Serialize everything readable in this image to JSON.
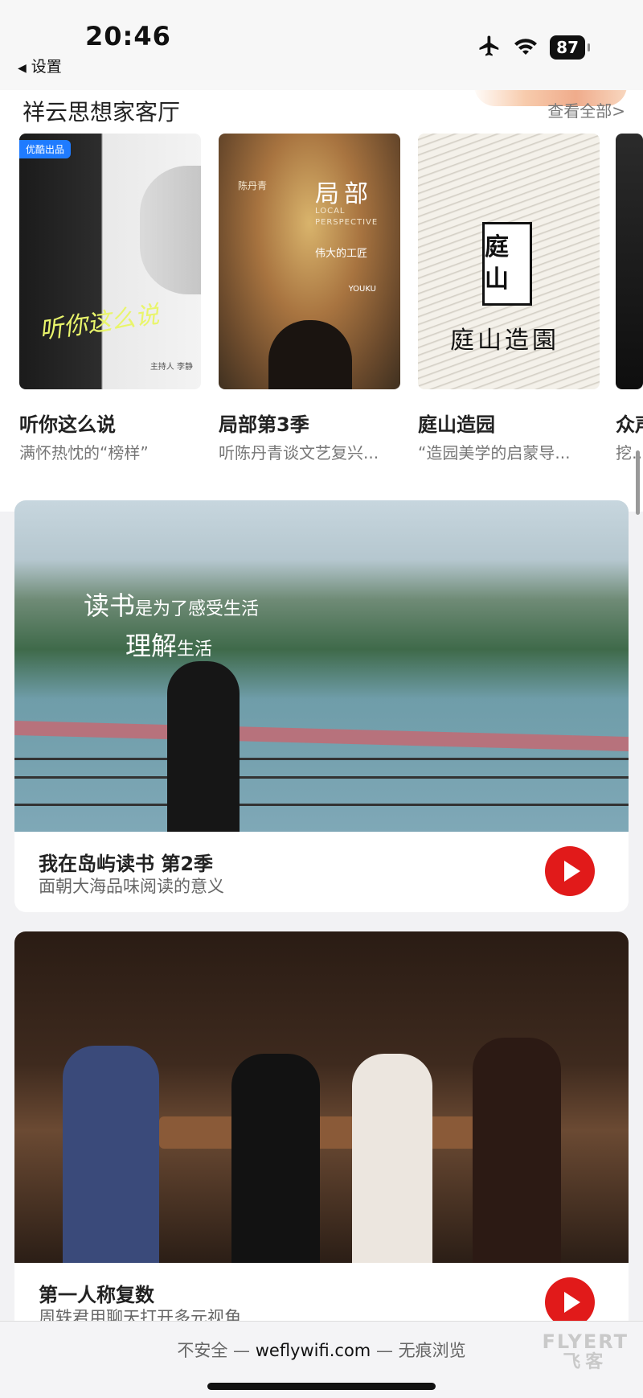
{
  "status": {
    "time": "20:46",
    "back_label": "设置",
    "battery": "87",
    "icons": [
      "airplane-icon",
      "wifi-icon",
      "battery-icon"
    ]
  },
  "section": {
    "title": "祥云思想家客厅",
    "see_all": "查看全部>"
  },
  "shows": [
    {
      "title": "听你这么说",
      "subtitle": "满怀热忱的“榜样”",
      "poster_badge": "优酷出品",
      "poster_text": "听你这么说",
      "poster_host": "主持人 李静"
    },
    {
      "title": "局部第3季",
      "subtitle": "听陈丹青谈文艺复兴...",
      "poster_text": "局部",
      "poster_en": "LOCAL PERSPECTIVE",
      "poster_sub": "伟大的工匠",
      "poster_name": "陈丹青",
      "poster_logo": "YOUKU"
    },
    {
      "title": "庭山造园",
      "subtitle": "“造园美学的启蒙导...",
      "poster_seal": "庭山",
      "poster_text": "庭山造園"
    },
    {
      "title": "众声",
      "subtitle": "挖掘"
    }
  ],
  "features": [
    {
      "title": "我在岛屿读书 第2季",
      "subtitle": "面朝大海品味阅读的意义",
      "overlay_line1_a": "读书",
      "overlay_line1_b": "是为了感受生活",
      "overlay_line2_a": "理解",
      "overlay_line2_b": "生活"
    },
    {
      "title": "第一人称复数",
      "subtitle": "周轶君用聊天打开多元视角"
    }
  ],
  "browser": {
    "security": "不安全",
    "sep": "—",
    "domain": "weflywifi.com",
    "mode": "无痕浏览"
  },
  "watermark": {
    "en": "FLYERT",
    "zh": "飞客"
  }
}
